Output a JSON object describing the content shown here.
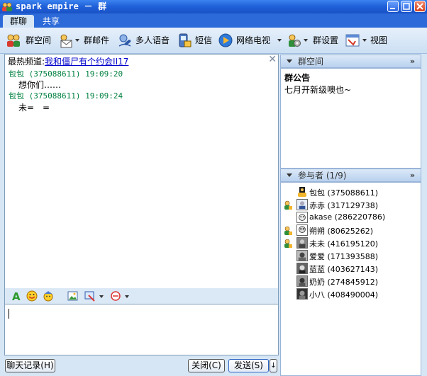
{
  "window": {
    "title": "spark empire － 群"
  },
  "tabs": [
    "群聊",
    "共享"
  ],
  "toolbar": {
    "items": [
      {
        "label": "群空间",
        "icon": "group-space-icon"
      },
      {
        "label": "群邮件",
        "icon": "group-mail-icon"
      },
      {
        "label": "多人语音",
        "icon": "voice-icon"
      },
      {
        "label": "短信",
        "icon": "sms-icon"
      },
      {
        "label": "网络电视",
        "icon": "tv-icon"
      },
      {
        "label": "群设置",
        "icon": "group-settings-icon"
      },
      {
        "label": "视图",
        "icon": "view-icon"
      }
    ]
  },
  "chat": {
    "hot_label": "最热频道:",
    "hot_link": "我和僵尸有个约会II17",
    "messages": [
      {
        "sender": "包包 (375088611) 19:09:20",
        "text": "想你们……"
      },
      {
        "sender": "包包 (375088611) 19:09:24",
        "text": "未=　="
      }
    ]
  },
  "input_toolbar": [
    "font-icon",
    "emoticon-icon",
    "magic-emoticon-icon",
    "send-image-icon",
    "screenshot-icon",
    "shake-icon"
  ],
  "buttons": {
    "history": "聊天记录(H)",
    "close": "关闭(C)",
    "send": "发送(S)",
    "send_arrow": "↓"
  },
  "group_space": {
    "title": "群空间",
    "notice_title": "群公告",
    "notice_text": "七月开新级噢也~"
  },
  "members_panel": {
    "title": "参与者 (1/9)",
    "members": [
      {
        "name": "包包 (375088611)",
        "badge": ""
      },
      {
        "name": "赤赤 (317129738)",
        "badge": "admin"
      },
      {
        "name": "akase (286220786)",
        "badge": ""
      },
      {
        "name": "朔朔 (80625262)",
        "badge": "admin"
      },
      {
        "name": "未未 (416195120)",
        "badge": "admin"
      },
      {
        "name": "爱爱 (171393588)",
        "badge": ""
      },
      {
        "name": "蓝蓝 (403627143)",
        "badge": ""
      },
      {
        "name": "奶奶 (274845912)",
        "badge": ""
      },
      {
        "name": "小八 (408490004)",
        "badge": ""
      }
    ]
  },
  "colors": {
    "titlebar": "#1f5fd8",
    "panel_bg": "#d6e6f5",
    "sender": "#008040",
    "link": "#0000cc"
  }
}
